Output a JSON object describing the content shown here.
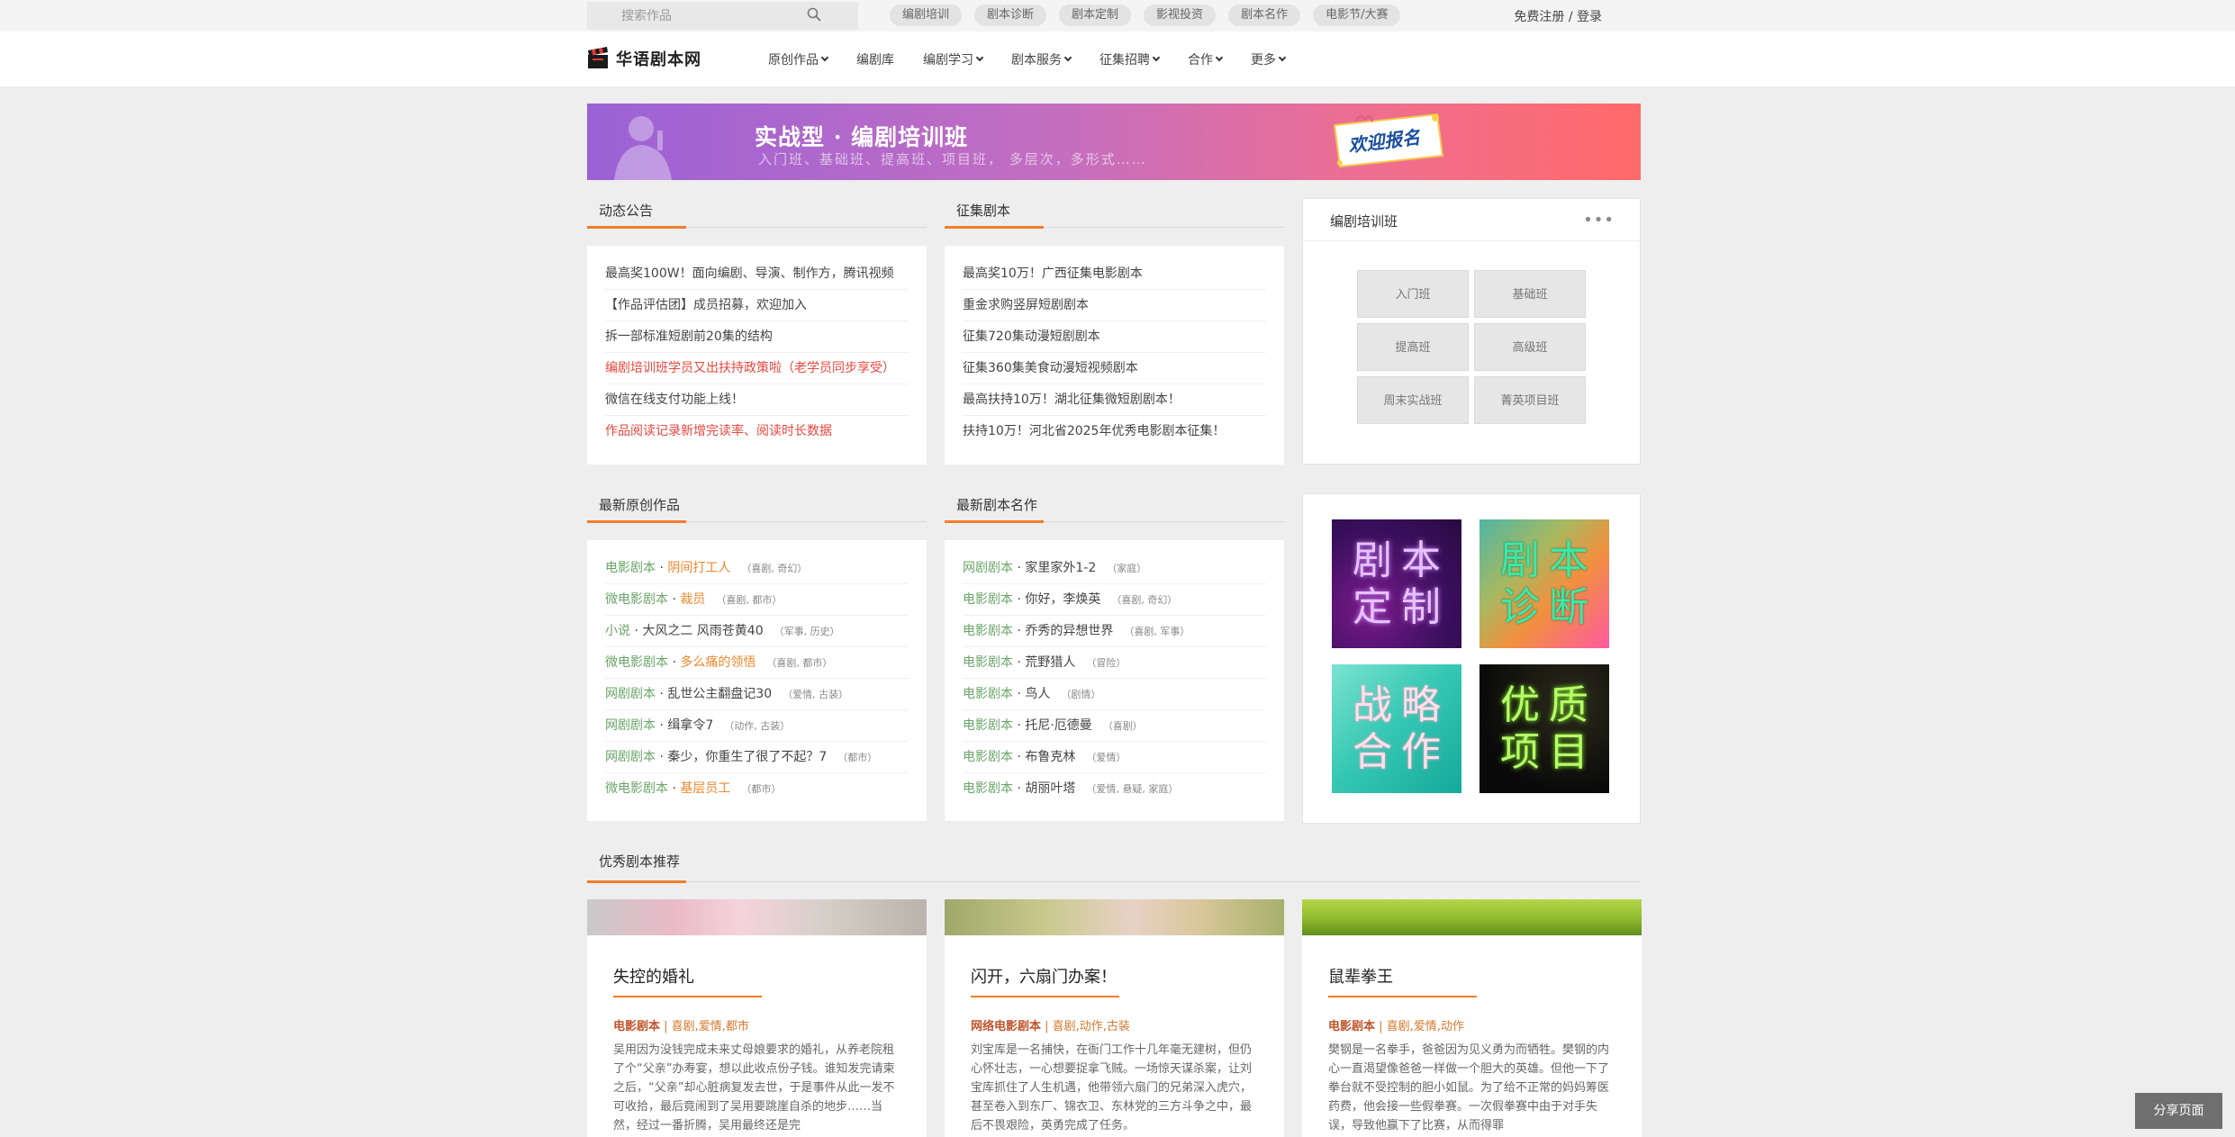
{
  "topbar": {
    "search_placeholder": "搜索作品",
    "quick_tags": [
      "编剧培训",
      "剧本诊断",
      "剧本定制",
      "影视投资",
      "剧本名作",
      "电影节/大赛"
    ],
    "register": "免费注册",
    "separator": " / ",
    "login": "登录"
  },
  "header": {
    "logo_text": "华语剧本网",
    "nav": [
      {
        "label": "原创作品",
        "dropdown": true
      },
      {
        "label": "编剧库",
        "dropdown": false
      },
      {
        "label": "编剧学习",
        "dropdown": true
      },
      {
        "label": "剧本服务",
        "dropdown": true
      },
      {
        "label": "征集招聘",
        "dropdown": true
      },
      {
        "label": "合作",
        "dropdown": true
      },
      {
        "label": "更多",
        "dropdown": true
      }
    ]
  },
  "banner": {
    "title": "实战型 · 编剧培训班",
    "subtitle": "入门班、基础班、提高班、项目班， 多层次，多形式……",
    "cta": "欢迎报名"
  },
  "announcements": {
    "heading": "动态公告",
    "items": [
      {
        "text": "最高奖100W！面向编剧、导演、制作方，腾讯视频",
        "red": false
      },
      {
        "text": "【作品评估团】成员招募，欢迎加入",
        "red": false
      },
      {
        "text": "拆一部标准短剧前20集的结构",
        "red": false
      },
      {
        "text": "编剧培训班学员又出扶持政策啦（老学员同步享受）",
        "red": true
      },
      {
        "text": "微信在线支付功能上线！",
        "red": false
      },
      {
        "text": "作品阅读记录新增完读率、阅读时长数据",
        "red": true
      }
    ]
  },
  "solicitations": {
    "heading": "征集剧本",
    "items": [
      "最高奖10万！广西征集电影剧本",
      "重金求购竖屏短剧剧本",
      "征集720集动漫短剧剧本",
      "征集360集美食动漫短视频剧本",
      "最高扶持10万！湖北征集微短剧剧本！",
      "扶持10万！河北省2025年优秀电影剧本征集！"
    ]
  },
  "training": {
    "heading": "编剧培训班",
    "more": "•••",
    "classes": [
      "入门班",
      "基础班",
      "提高班",
      "高级班",
      "周末实战班",
      "菁英项目班"
    ]
  },
  "latest_original": {
    "heading": "最新原创作品",
    "items": [
      {
        "category": "电影剧本",
        "title": "阴间打工人",
        "tags": "（喜剧, 奇幻）",
        "orange": true
      },
      {
        "category": "微电影剧本",
        "title": "裁员",
        "tags": "（喜剧, 都市）",
        "orange": true
      },
      {
        "category": "小说",
        "title": "大风之二 风雨苍黄40",
        "tags": "（军事, 历史）",
        "orange": false
      },
      {
        "category": "微电影剧本",
        "title": "多么痛的领悟",
        "tags": "（喜剧, 都市）",
        "orange": true
      },
      {
        "category": "网剧剧本",
        "title": "乱世公主翻盘记30",
        "tags": "（爱情, 古装）",
        "orange": false
      },
      {
        "category": "网剧剧本",
        "title": "缉拿令7",
        "tags": "（动作, 古装）",
        "orange": false
      },
      {
        "category": "网剧剧本",
        "title": "秦少，你重生了很了不起？7",
        "tags": "（都市）",
        "orange": false
      },
      {
        "category": "微电影剧本",
        "title": "基层员工",
        "tags": "（都市）",
        "orange": true
      }
    ]
  },
  "latest_masterpieces": {
    "heading": "最新剧本名作",
    "items": [
      {
        "category": "网剧剧本",
        "title": "家里家外1-2",
        "tags": "（家庭）"
      },
      {
        "category": "电影剧本",
        "title": "你好，李焕英",
        "tags": "（喜剧, 奇幻）"
      },
      {
        "category": "电影剧本",
        "title": "乔秀的异想世界",
        "tags": "（喜剧, 军事）"
      },
      {
        "category": "电影剧本",
        "title": "荒野猎人",
        "tags": "（冒险）"
      },
      {
        "category": "电影剧本",
        "title": "鸟人",
        "tags": "（剧情）"
      },
      {
        "category": "电影剧本",
        "title": "托尼·厄德曼",
        "tags": "（喜剧）"
      },
      {
        "category": "电影剧本",
        "title": "布鲁克林",
        "tags": "（爱情）"
      },
      {
        "category": "电影剧本",
        "title": "胡丽叶塔",
        "tags": "（爱情, 悬疑, 家庭）"
      }
    ]
  },
  "services": [
    {
      "line1": "剧本",
      "line2": "定制"
    },
    {
      "line1": "剧本",
      "line2": "诊断"
    },
    {
      "line1": "战略",
      "line2": "合作"
    },
    {
      "line1": "优质",
      "line2": "项目"
    }
  ],
  "recommended": {
    "heading": "优秀剧本推荐",
    "cards": [
      {
        "title": "失控的婚礼",
        "type": "电影剧本",
        "separator": " | ",
        "genres": "喜剧,爱情,都市",
        "desc": "吴用因为没钱完成未来丈母娘要求的婚礼，从养老院租了个“父亲”办寿宴，想以此收点份子钱。谁知发完请柬之后，“父亲”却心脏病复发去世，于是事件从此一发不可收拾，最后竟闹到了吴用要跳崖自杀的地步……当然，经过一番折腾，吴用最终还是完"
      },
      {
        "title": "闪开，六扇门办案！",
        "type": "网络电影剧本",
        "separator": " | ",
        "genres": "喜剧,动作,古装",
        "desc": "刘宝库是一名捕快，在衙门工作十几年毫无建树，但仍心怀壮志，一心想要捉拿飞贼。一场惊天谋杀案，让刘宝库抓住了人生机遇，他带领六扇门的兄弟深入虎穴，甚至卷入到东厂、锦衣卫、东林党的三方斗争之中，最后不畏艰险，英勇完成了任务。"
      },
      {
        "title": "鼠辈拳王",
        "type": "电影剧本",
        "separator": " | ",
        "genres": "喜剧,爱情,动作",
        "desc": "樊钢是一名拳手，爸爸因为见义勇为而牺牲。樊钢的内心一直渴望像爸爸一样做一个胆大的英雄。但他一下了拳台就不受控制的胆小如鼠。为了给不正常的妈妈筹医药费，他会接一些假拳赛。一次假拳赛中由于对手失误，导致他赢下了比赛，从而得罪"
      }
    ]
  },
  "share": {
    "label": "分享页面"
  },
  "colors": {
    "accent": "#f07e2a",
    "notice_red": "#e8473d",
    "category_green": "#6aa56a"
  }
}
